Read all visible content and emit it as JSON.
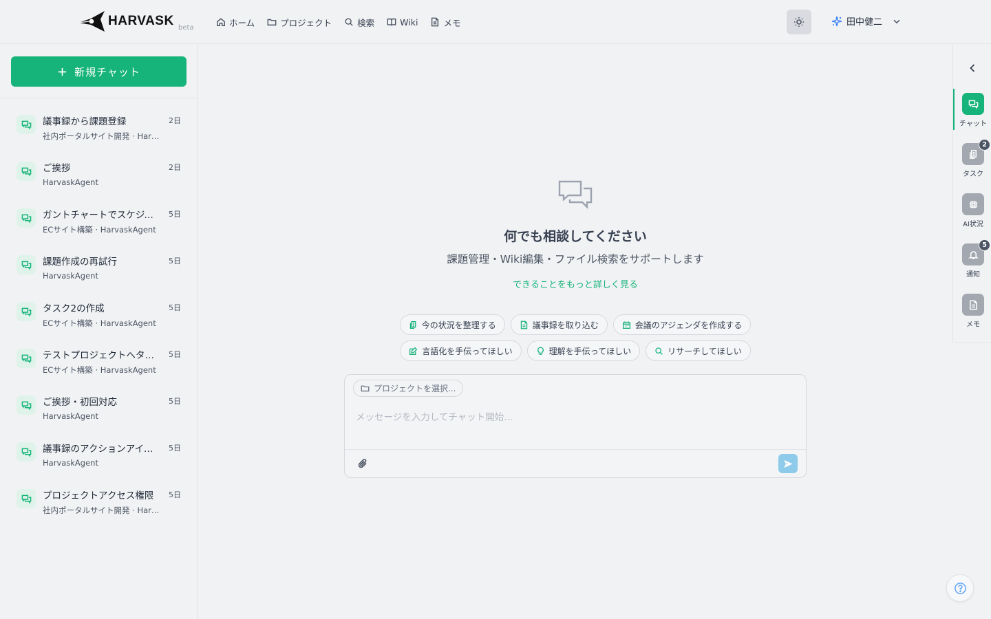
{
  "header": {
    "brand": "HARVASK",
    "beta": "beta",
    "nav": [
      {
        "label": "ホーム",
        "icon": "home-icon"
      },
      {
        "label": "プロジェクト",
        "icon": "folder-icon"
      },
      {
        "label": "検索",
        "icon": "search-icon"
      },
      {
        "label": "Wiki",
        "icon": "book-icon"
      },
      {
        "label": "メモ",
        "icon": "memo-icon"
      }
    ],
    "user_name": "田中健二"
  },
  "sidebar": {
    "new_chat_label": "新規チャット",
    "chats": [
      {
        "title": "議事録から課題登録",
        "sub": "社内ポータルサイト開発 · HarvaskAgent",
        "date": "2日"
      },
      {
        "title": "ご挨拶",
        "sub": "HarvaskAgent",
        "date": "2日"
      },
      {
        "title": "ガントチャートでスケジュール",
        "sub": "ECサイト構築 · HarvaskAgent",
        "date": "5日"
      },
      {
        "title": "課題作成の再試行",
        "sub": "HarvaskAgent",
        "date": "5日"
      },
      {
        "title": "タスク2の作成",
        "sub": "ECサイト構築 · HarvaskAgent",
        "date": "5日"
      },
      {
        "title": "テストプロジェクトへタスク",
        "sub": "ECサイト構築 · HarvaskAgent",
        "date": "5日"
      },
      {
        "title": "ご挨拶・初回対応",
        "sub": "HarvaskAgent",
        "date": "5日"
      },
      {
        "title": "議事録のアクションアイテム",
        "sub": "HarvaskAgent",
        "date": "5日"
      },
      {
        "title": "プロジェクトアクセス権限",
        "sub": "社内ポータルサイト開発 · HarvaskAgent",
        "date": "5日"
      }
    ]
  },
  "main": {
    "title": "何でも相談してください",
    "subtitle": "課題管理・Wiki編集・ファイル検索をサポートします",
    "learn_more": "できることをもっと詳しく見る",
    "suggestions_row1": [
      {
        "label": "今の状況を整理する",
        "icon": "copy-icon"
      },
      {
        "label": "議事録を取り込む",
        "icon": "document-icon"
      },
      {
        "label": "会議のアジェンダを作成する",
        "icon": "calendar-icon"
      }
    ],
    "suggestions_row2": [
      {
        "label": "言語化を手伝ってほしい",
        "icon": "edit-icon"
      },
      {
        "label": "理解を手伝ってほしい",
        "icon": "lightbulb-icon"
      },
      {
        "label": "リサーチしてほしい",
        "icon": "search-icon"
      }
    ],
    "composer": {
      "project_select": "プロジェクトを選択...",
      "placeholder": "メッセージを入力してチャット開始...",
      "value": ""
    }
  },
  "rail": {
    "items": [
      {
        "label": "チャット",
        "icon": "chat-icon",
        "active": true,
        "badge": ""
      },
      {
        "label": "タスク",
        "icon": "clipboard-icon",
        "active": false,
        "badge": "2"
      },
      {
        "label": "AI状況",
        "icon": "chip-icon",
        "active": false,
        "badge": ""
      },
      {
        "label": "通知",
        "icon": "bell-icon",
        "active": false,
        "badge": "5"
      },
      {
        "label": "メモ",
        "icon": "memo-icon",
        "active": false,
        "badge": ""
      }
    ]
  },
  "colors": {
    "accent": "#16b37a",
    "background": "#f1f2f4",
    "send_button": "#8ecae9",
    "help_icon": "#60a5fa"
  }
}
